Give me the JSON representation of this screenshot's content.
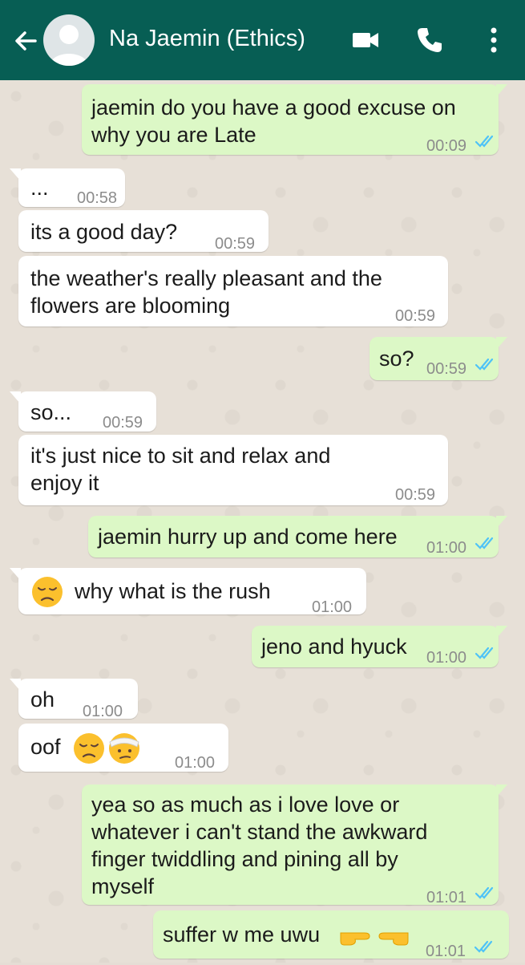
{
  "header": {
    "contact_name": "Na Jaemin (Ethics)",
    "icons": [
      "back-arrow-icon",
      "avatar",
      "video-call-icon",
      "phone-call-icon",
      "more-options-icon"
    ],
    "colors": {
      "bar": "#075e54",
      "outgoing": "#dcf8c6",
      "incoming": "#ffffff",
      "read_tick": "#4fc3f7"
    }
  },
  "messages": [
    {
      "dir": "out",
      "text": "jaemin do you have a  good excuse on\nwhy you are Late",
      "time": "00:09"
    },
    {
      "dir": "in",
      "text": "...",
      "time": "00:58"
    },
    {
      "dir": "in",
      "text": "its a good day?",
      "time": "00:59"
    },
    {
      "dir": "in",
      "text": "the weather's really pleasant and the\nflowers are blooming",
      "time": "00:59"
    },
    {
      "dir": "out",
      "text": "so?",
      "time": "00:59"
    },
    {
      "dir": "in",
      "text": "so...",
      "time": "00:59"
    },
    {
      "dir": "in",
      "text": "it's just nice to sit and relax and\nenjoy it",
      "time": "00:59"
    },
    {
      "dir": "out",
      "text": "jaemin hurry up and come here",
      "time": "01:00"
    },
    {
      "dir": "in",
      "text": "why what is the rush",
      "time": "01:00",
      "emoji": [
        "disappointed-face-emoji"
      ]
    },
    {
      "dir": "out",
      "text": "jeno and hyuck",
      "time": "01:00"
    },
    {
      "dir": "in",
      "text": "oh",
      "time": "01:00"
    },
    {
      "dir": "in",
      "text": "oof",
      "time": "01:00",
      "emoji": [
        "disappointed-face-emoji",
        "bandaged-head-face-emoji"
      ]
    },
    {
      "dir": "out",
      "text": "yea so as much as i love love or\nwhatever i can't stand the awkward\nfinger twiddling and pining all by\nmyself",
      "time": "01:01"
    },
    {
      "dir": "out",
      "text": "suffer w me uwu",
      "time": "01:01",
      "emoji": [
        "pointing-right-emoji",
        "pointing-left-emoji"
      ]
    }
  ]
}
